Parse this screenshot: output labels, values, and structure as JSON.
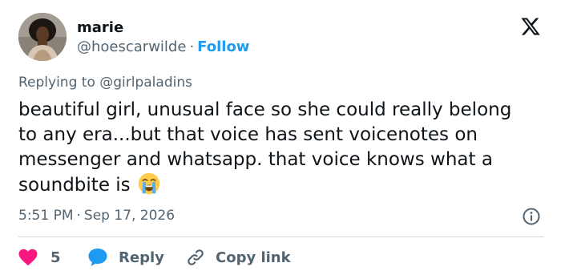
{
  "author": {
    "name": "marie",
    "handle": "@hoescarwilde",
    "separator": "·",
    "follow_label": "Follow"
  },
  "icons": {
    "logo": "x-logo-icon",
    "emoji": "loudly-crying-face-icon",
    "info": "info-icon",
    "like": "heart-icon",
    "reply": "speech-bubble-icon",
    "copy": "link-icon"
  },
  "colors": {
    "accent": "#1d9bf0",
    "like": "#f91880",
    "muted": "#536471",
    "text": "#0f1419"
  },
  "reply_context": {
    "prefix": "Replying to",
    "mention": "@girlpaladins"
  },
  "tweet": {
    "text": "beautiful girl, unusual face so she could really belong to any era...but that voice has sent voicenotes on messenger and whatsapp. that voice knows what a soundbite is",
    "time": "5:51 PM",
    "separator": "·",
    "date": "Sep 17, 2026"
  },
  "actions": {
    "like_count": "5",
    "reply_label": "Reply",
    "copy_label": "Copy link"
  }
}
